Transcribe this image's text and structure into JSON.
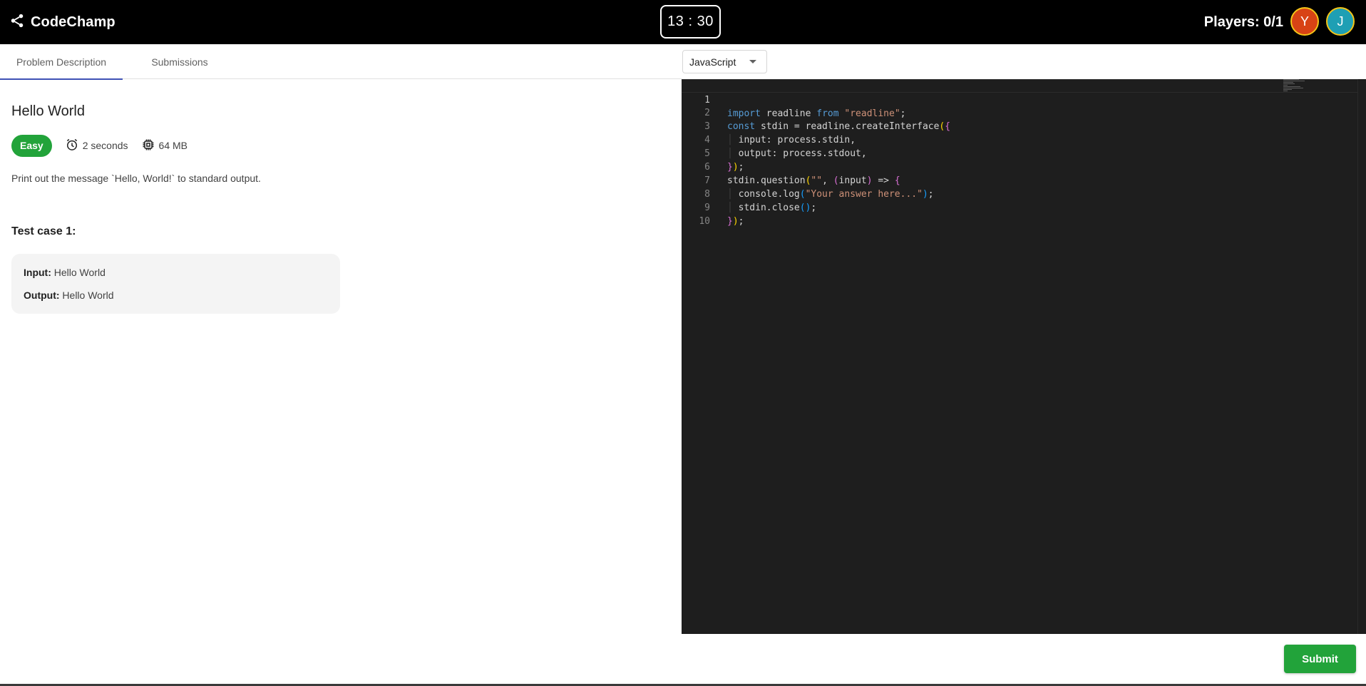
{
  "header": {
    "brand": "CodeChamp",
    "timer": "13 : 30",
    "players": "Players: 0/1",
    "avatars": [
      {
        "initial": "Y",
        "color": "#d84315"
      },
      {
        "initial": "J",
        "color": "#1e9fb4"
      }
    ]
  },
  "tabs": [
    {
      "label": "Problem Description",
      "active": true
    },
    {
      "label": "Submissions",
      "active": false
    }
  ],
  "problem": {
    "title": "Hello World",
    "difficulty": "Easy",
    "time_limit": "2 seconds",
    "memory_limit": "64 MB",
    "description": "Print out the message `Hello, World!` to standard output.",
    "test_case": {
      "title": "Test case 1:",
      "input_label": "Input:",
      "input_value": "Hello World",
      "output_label": "Output:",
      "output_value": "Hello World"
    }
  },
  "language": {
    "selected": "JavaScript"
  },
  "editor": {
    "line_numbers": [
      "1",
      "2",
      "3",
      "4",
      "5",
      "6",
      "7",
      "8",
      "9",
      "10"
    ],
    "lines": [
      "import readline from \"readline\";",
      "const stdin = readline.createInterface({",
      "  input: process.stdin,",
      "  output: process.stdout,",
      "});",
      "stdin.question(\"\", (input) => {",
      "  console.log(\"Your answer here...\");",
      "  stdin.close();",
      "});",
      ""
    ]
  },
  "actions": {
    "submit_label": "Submit"
  },
  "colors": {
    "topbar": "#000000",
    "accent_green": "#22a33a",
    "tab_indicator": "#3f51b5",
    "editor_bg": "#1e1e1e"
  }
}
